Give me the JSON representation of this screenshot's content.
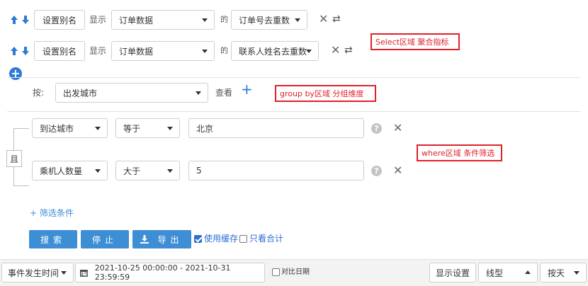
{
  "select_section": {
    "rows": [
      {
        "alias_button": "设置别名",
        "show_label": "显示",
        "source": "订单数据",
        "of_label": "的",
        "metric": "订单号去重数"
      },
      {
        "alias_button": "设置别名",
        "show_label": "显示",
        "source": "订单数据",
        "of_label": "的",
        "metric": "联系人姓名去重数"
      }
    ],
    "annotation": "Select区域  聚合指标"
  },
  "group_section": {
    "by_label": "按:",
    "dimension": "出发城市",
    "view_label": "查看",
    "annotation": "group by区域  分组维度"
  },
  "where_section": {
    "logic_label": "且",
    "conditions": [
      {
        "field": "到达城市",
        "operator": "等于",
        "value": "北京"
      },
      {
        "field": "乘机人数量",
        "operator": "大于",
        "value": "5"
      }
    ],
    "annotation": "where区域  条件筛选",
    "add_filter": "+ 筛选条件"
  },
  "actions": {
    "search": "搜索",
    "stop": "停止",
    "export": "导出",
    "use_cache": "使用缓存",
    "use_cache_checked": true,
    "only_total": "只看合计",
    "only_total_checked": false
  },
  "bottom_bar": {
    "time_field": "事件发生时间",
    "date_range": "2021-10-25 00:00:00 - 2021-10-31 23:59:59",
    "compare_date": "对比日期",
    "display_settings": "显示设置",
    "chart_type": "线型",
    "granularity": "按天"
  },
  "colors": {
    "accent": "#3e8ed6",
    "annotation_red": "#e0212a",
    "sort_arrow_blue": "#2d7bd6"
  },
  "icons": [
    "arrow-up-icon",
    "arrow-down-icon",
    "close-icon",
    "swap-icon",
    "plus-circle-icon",
    "plus-icon",
    "help-icon",
    "calendar-icon",
    "download-icon",
    "chevron-down-icon",
    "chevron-up-icon"
  ]
}
